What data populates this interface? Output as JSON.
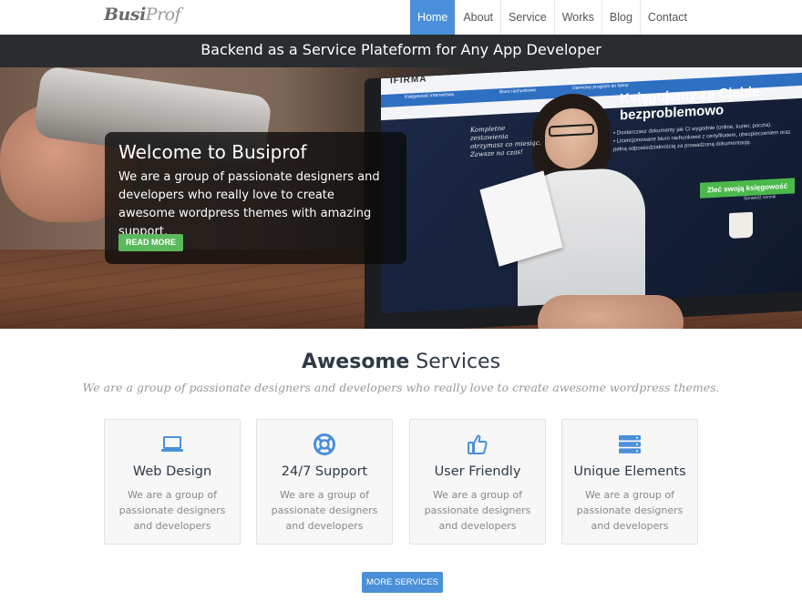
{
  "brand": {
    "logo_part1": "Busi",
    "logo_part2": "Prof"
  },
  "nav": {
    "items": [
      {
        "label": "Home",
        "active": true
      },
      {
        "label": "About",
        "active": false
      },
      {
        "label": "Service",
        "active": false
      },
      {
        "label": "Works",
        "active": false
      },
      {
        "label": "Blog",
        "active": false
      },
      {
        "label": "Contact",
        "active": false
      }
    ]
  },
  "tagline": "Backend as a Service Plateform for Any App Developer",
  "hero": {
    "title": "Welcome to Busiprof",
    "text": "We are a group of passionate designers and developers who really love to create awesome wordpress themes with amazing support.",
    "button_label": "READ MORE",
    "screen": {
      "brand": "IFIRMA",
      "tabs": [
        "Księgowość internetowa",
        "Biuro rachunkowe",
        "Darmowy program do faktur"
      ],
      "headline": "Księgujemy za Ciebie bezproblemowo",
      "note": "Kompletne zestawienia otrzymasz co miesiąc. Zawsze na czas!",
      "list": [
        "• Dostarczasz dokumenty jak Ci wygodnie (online, kurier, poczta).",
        "• Licencjonowane biuro rachunkowe z certyfikatem, ubezpieczeniem oraz pełną odpowiedzialnością za prowadzoną dokumentację."
      ],
      "cta": "Zleć swoją księgowość",
      "cta_sub": "Sprawdź cennik"
    }
  },
  "services": {
    "title_bold": "Awesome",
    "title_rest": " Services",
    "subtitle": "We are a group of passionate designers and developers who really love to create awesome wordpress themes.",
    "cards": [
      {
        "icon": "laptop-icon",
        "name": "Web Design",
        "desc": "We are a group of passionate designers and developers"
      },
      {
        "icon": "lifebuoy-icon",
        "name": "24/7 Support",
        "desc": "We are a group of passionate designers and developers"
      },
      {
        "icon": "thumbs-up-icon",
        "name": "User Friendly",
        "desc": "We are a group of passionate designers and developers"
      },
      {
        "icon": "server-icon",
        "name": "Unique Elements",
        "desc": "We are a group of passionate designers and developers"
      }
    ],
    "more_button": "MORE SERVICES"
  },
  "colors": {
    "accent": "#4a90d9",
    "green": "#5cb85c",
    "dark_bar": "#2a2d30"
  }
}
